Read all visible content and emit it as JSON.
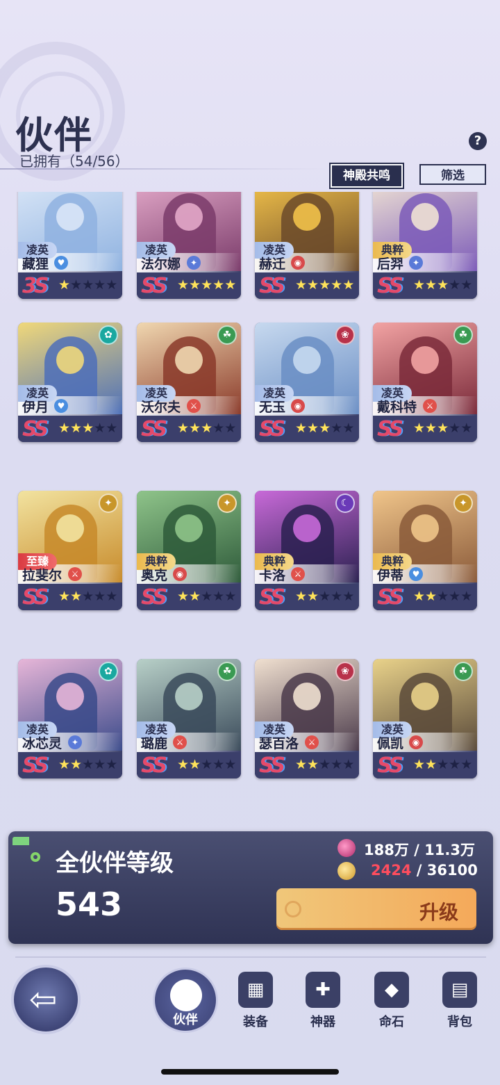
{
  "header": {
    "title": "伙伴",
    "owned": "已拥有（54/56）",
    "help": "?",
    "temple_button": "神殿共鸣",
    "filter_button": "筛选"
  },
  "colors": {
    "dark_navy": "#2a2f4e",
    "card_bottom": "#3b3f6b",
    "star": "#ffe35a",
    "grade": "#e54a6a",
    "upgrade_button": "#f4a95a",
    "insufficient": "#ff4d5e"
  },
  "partners": [
    {
      "rarity": "凌英",
      "name": "藏狸",
      "grade": "3S",
      "stars": 1,
      "element": "",
      "class_icon": "heart-icon",
      "bg": [
        "#d9e6f7",
        "#8fb2e0"
      ]
    },
    {
      "rarity": "凌英",
      "name": "法尔娜",
      "grade": "SS",
      "stars": 5,
      "element": "",
      "class_icon": "staff-icon",
      "bg": [
        "#e3a9c9",
        "#7a3b6a"
      ]
    },
    {
      "rarity": "凌英",
      "name": "赫迁",
      "grade": "SS",
      "stars": 5,
      "element": "",
      "class_icon": "shield-icon",
      "bg": [
        "#f2c24a",
        "#6b4a2a"
      ]
    },
    {
      "rarity": "典粹",
      "name": "后羿",
      "grade": "SS",
      "stars": 3,
      "element": "",
      "class_icon": "staff-icon",
      "bg": [
        "#efe2d4",
        "#7b5ab8"
      ]
    },
    {
      "rarity": "凌英",
      "name": "伊月",
      "grade": "SS",
      "stars": 3,
      "element": "wind-icon",
      "class_icon": "heart-icon",
      "bg": [
        "#f0d87a",
        "#4d6fb8"
      ]
    },
    {
      "rarity": "凌英",
      "name": "沃尔夫",
      "grade": "SS",
      "stars": 3,
      "element": "leaf-icon",
      "class_icon": "sword-icon",
      "bg": [
        "#f0d7b0",
        "#8a3a2a"
      ]
    },
    {
      "rarity": "凌英",
      "name": "无玉",
      "grade": "SS",
      "stars": 3,
      "element": "fire-icon",
      "class_icon": "shield-icon",
      "bg": [
        "#c7d9ef",
        "#6a8ec4"
      ]
    },
    {
      "rarity": "凌英",
      "name": "戴科特",
      "grade": "SS",
      "stars": 3,
      "element": "leaf-icon",
      "class_icon": "sword-icon",
      "bg": [
        "#f2a3a3",
        "#7a2a3a"
      ]
    },
    {
      "rarity": "至臻",
      "name": "拉斐尔",
      "grade": "SS",
      "stars": 2,
      "element": "light-icon",
      "class_icon": "sword-icon",
      "bg": [
        "#f2e3a0",
        "#c78a2a"
      ]
    },
    {
      "rarity": "典粹",
      "name": "奥克",
      "grade": "SS",
      "stars": 2,
      "element": "light-icon",
      "class_icon": "shield-icon",
      "bg": [
        "#8fc48a",
        "#2e5a3a"
      ]
    },
    {
      "rarity": "典粹",
      "name": "卡洛",
      "grade": "SS",
      "stars": 2,
      "element": "dark-icon",
      "class_icon": "sword-icon",
      "bg": [
        "#c86ad8",
        "#2a2050"
      ]
    },
    {
      "rarity": "典粹",
      "name": "伊蒂",
      "grade": "SS",
      "stars": 2,
      "element": "light-icon",
      "class_icon": "heart-icon",
      "bg": [
        "#f0c58a",
        "#8a5a3a"
      ]
    },
    {
      "rarity": "凌英",
      "name": "冰芯灵",
      "grade": "SS",
      "stars": 2,
      "element": "wind-icon",
      "class_icon": "staff-icon",
      "bg": [
        "#e7b6d8",
        "#3a4a8a"
      ]
    },
    {
      "rarity": "凌英",
      "name": "璐鹿",
      "grade": "SS",
      "stars": 2,
      "element": "leaf-icon",
      "class_icon": "sword-icon",
      "bg": [
        "#b8d0c8",
        "#3a4a5a"
      ]
    },
    {
      "rarity": "凌英",
      "name": "瑟百洛",
      "grade": "SS",
      "stars": 2,
      "element": "fire-icon",
      "class_icon": "sword-icon",
      "bg": [
        "#f0e0d0",
        "#4a3a4a"
      ]
    },
    {
      "rarity": "凌英",
      "name": "佩凯",
      "grade": "SS",
      "stars": 2,
      "element": "leaf-icon",
      "class_icon": "shield-icon",
      "bg": [
        "#e9d28a",
        "#5a4a3a"
      ]
    }
  ],
  "level_panel": {
    "label": "全伙伴等级",
    "value": "543",
    "resource1": "188万 / 11.3万",
    "resource2_have": "2424",
    "resource2_need": " / 36100",
    "upgrade_button": "升级"
  },
  "nav": {
    "active": "伙伴",
    "items": [
      "装备",
      "神器",
      "命石",
      "背包"
    ]
  }
}
